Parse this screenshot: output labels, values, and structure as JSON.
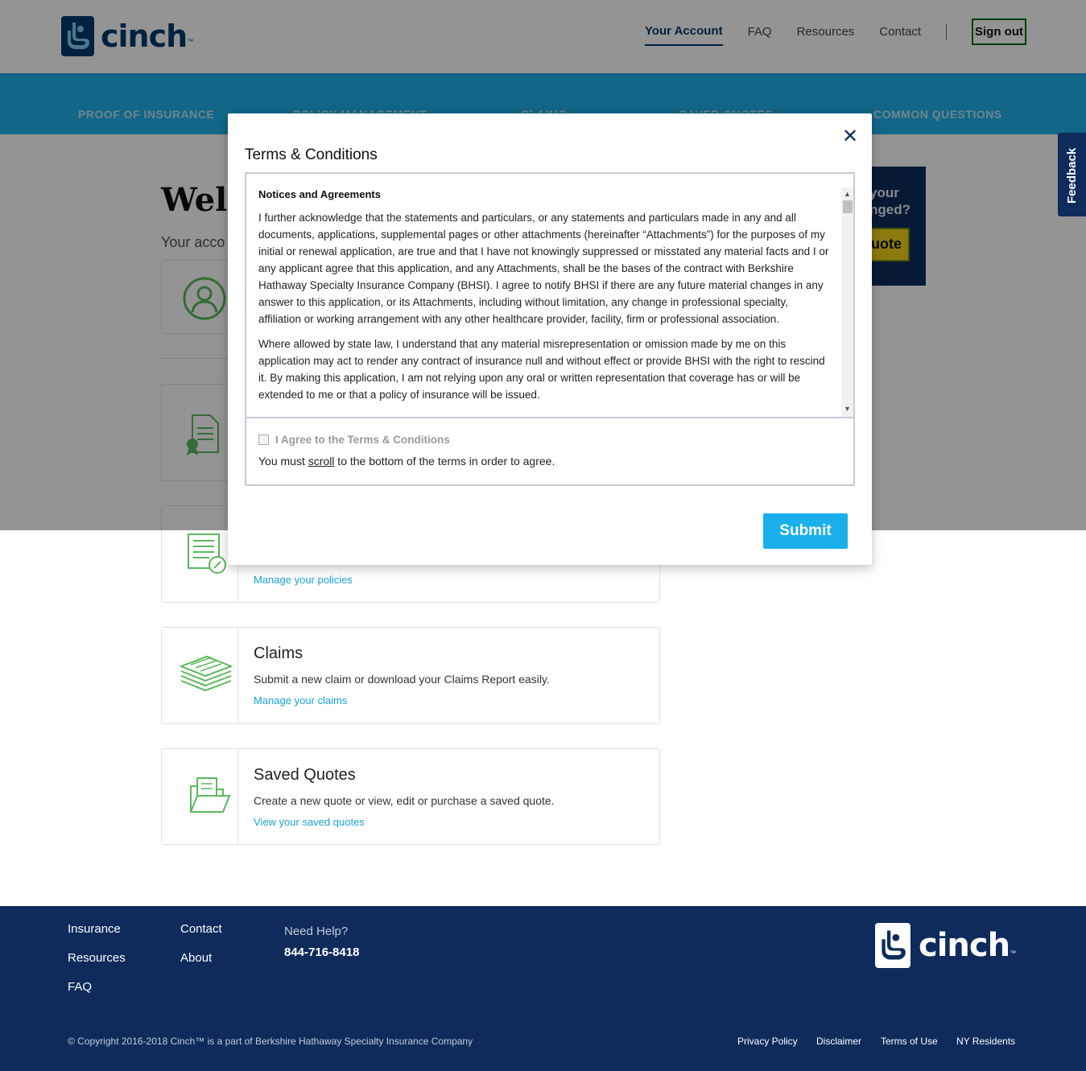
{
  "header": {
    "logo_text": "cinch",
    "logo_tm": "™",
    "nav": [
      "Your Account",
      "FAQ",
      "Resources",
      "Contact"
    ],
    "signout_label": "Sign out"
  },
  "subnav": {
    "items": [
      "PROOF OF INSURANCE",
      "POLICY MANAGEMENT",
      "CLAIMS",
      "SAVED QUOTES",
      "COMMON QUESTIONS"
    ]
  },
  "main": {
    "welcome": "Welc",
    "account_sub": "Your acco",
    "cards": [
      {
        "title": "",
        "desc": "",
        "link": "Manage your policies"
      },
      {
        "title": "Claims",
        "desc": "Submit a new claim or download your Claims Report easily.",
        "link": "Manage your claims"
      },
      {
        "title": "Saved Quotes",
        "desc": "Create a new quote or view, edit or purchase a saved quote.",
        "link": "View your saved quotes"
      }
    ],
    "promo_text_1": "your",
    "promo_text_2": "nged?",
    "promo_button": "uote",
    "feedback": "Feedback"
  },
  "modal": {
    "title": "Terms & Conditions",
    "close": "✕",
    "heading": "Notices and Agreements",
    "para1": "I further acknowledge that the statements and particulars, or any statements and particulars made in any and all documents, applications, supplemental pages or other attachments (hereinafter “Attachments”) for the purposes of my initial or renewal application, are true and that I have not knowingly suppressed or misstated any material facts and I or any applicant agree that this application, and any Attachments, shall be the bases of the contract with Berkshire Hathaway Specialty Insurance Company (BHSI). I agree to notify BHSI if there are any future material changes in any answer to this application, or its Attachments, including without limitation, any change in professional specialty, affiliation or working arrangement with any other healthcare provider, facility, firm or professional association.",
    "para2": "Where allowed by state law, I understand that any material misrepresentation or omission made by me on this application may act to render any contract of insurance null and without effect or provide BHSI with the right to rescind it. By making this application, I am not relying upon any oral or written representation that coverage has or will be extended to me or that a policy of insurance will be issued.",
    "agree_label": "I Agree to the Terms & Conditions",
    "must_scroll_pre": "You must ",
    "must_scroll_link": "scroll",
    "must_scroll_post": " to the bottom of the terms in order to agree.",
    "submit_label": "Submit"
  },
  "footer": {
    "col1": [
      "Insurance",
      "Resources",
      "FAQ"
    ],
    "col2": [
      "Contact",
      "About"
    ],
    "help_label": "Need Help?",
    "help_phone": "844-716-8418",
    "logo_text": "cinch",
    "logo_tm": "™",
    "copyright": "© Copyright 2016-2018 Cinch™ is a part of Berkshire Hathaway Specialty Insurance Company",
    "legal": [
      "Privacy Policy",
      "Disclaimer",
      "Terms of Use",
      "NY Residents"
    ]
  }
}
